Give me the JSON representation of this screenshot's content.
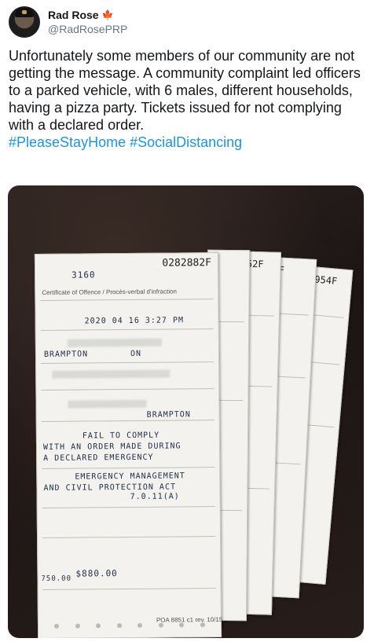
{
  "user": {
    "display_name": "Rad Rose",
    "flag_emoji": "🍁",
    "handle": "@RadRosePRP"
  },
  "tweet": {
    "text": "Unfortunately some members of our community are not getting the message. A community complaint led officers to a parked vehicle, with 6 males, different households, having a pizza party. Tickets issued for not complying with a declared order.",
    "hashtags": [
      "#PleaseStayHome",
      "#SocialDistancing"
    ]
  },
  "media": {
    "ticket_main_number": "0282882F",
    "ticket_main_prefix": "3160",
    "ticket_2_number": "952F",
    "ticket_3_number": "3F",
    "ticket_4_number": "3954F",
    "form_title": "Certificate of Offence / Procès-verbal d'infraction",
    "date_written": "2020 04 16 3:27 PM",
    "city_written": "BRAMPTON",
    "province_written": "ON",
    "offence_line_1": "FAIL TO COMPLY",
    "offence_line_2": "WITH AN ORDER MADE DURING",
    "offence_line_3": "A DECLARED EMERGENCY",
    "act_line_1": "EMERGENCY MANAGEMENT",
    "act_line_2": "AND CIVIL PROTECTION ACT",
    "section": "7.0.11(A)",
    "fine_amount": "$880.00",
    "set_fine": "750.00",
    "form_footer": "POA 8851 c1 rev. 10/15"
  }
}
